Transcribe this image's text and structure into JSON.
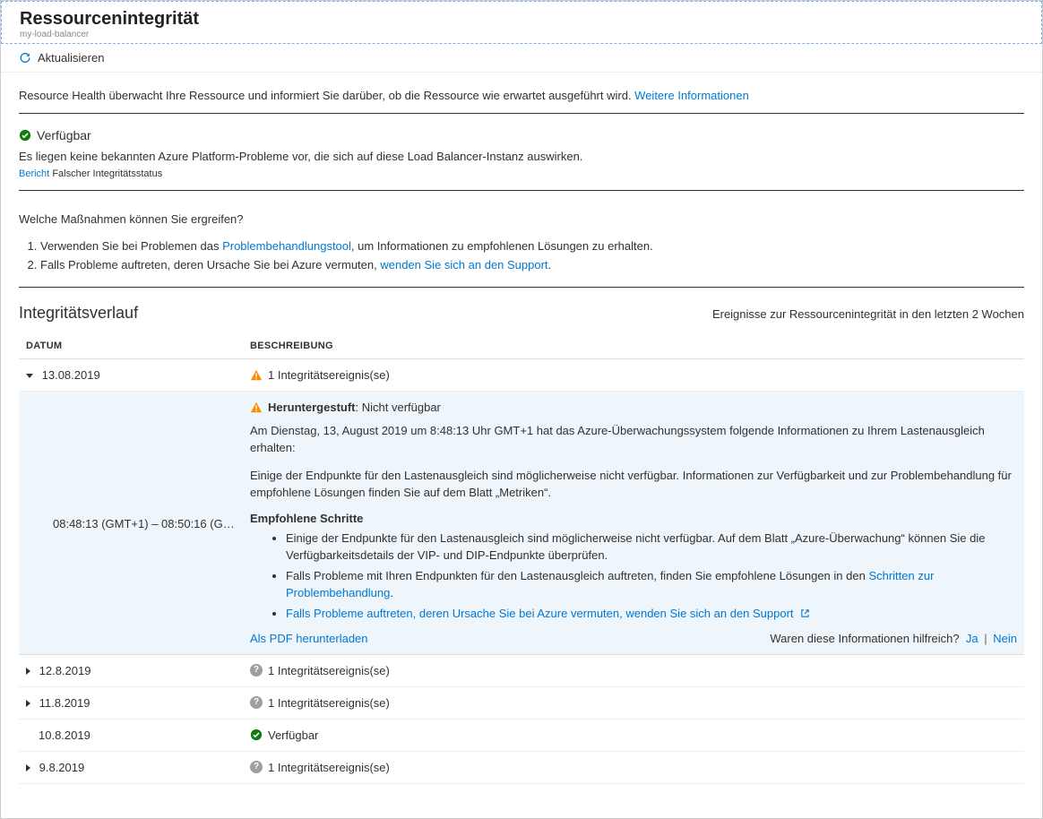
{
  "header": {
    "title": "Ressourcenintegrität",
    "subtitle": "my-load-balancer"
  },
  "toolbar": {
    "refresh_label": "Aktualisieren"
  },
  "intro": {
    "text": "Resource Health überwacht Ihre Ressource und informiert Sie darüber, ob die Ressource wie erwartet ausgeführt wird. ",
    "learn_more": "Weitere Informationen"
  },
  "status": {
    "label": "Verfügbar",
    "message": "Es liegen keine bekannten Azure Platform-Probleme vor, die sich auf diese Load Balancer-Instanz auswirken.",
    "report_link": "Bericht",
    "report_text": "Falscher Integritätsstatus"
  },
  "actions": {
    "question": "Welche Maßnahmen können Sie ergreifen?",
    "item1_a": "Verwenden Sie bei Problemen das ",
    "item1_link": "Problembehandlungstool",
    "item1_b": ", um Informationen zu empfohlenen Lösungen zu erhalten.",
    "item2_a": "Falls Probleme auftreten, deren Ursache Sie bei Azure vermuten, ",
    "item2_link": "wenden Sie sich an den Support",
    "item2_b": "."
  },
  "history": {
    "title": "Integritätsverlauf",
    "subtitle": "Ereignisse zur Ressourcenintegrität in den letzten 2 Wochen",
    "col_date": "Datum",
    "col_desc": "Beschreibung",
    "rows": [
      {
        "date": "13.08.2019",
        "desc": "1 Integritätsereignis(se)",
        "icon": "warn",
        "expanded": true
      },
      {
        "date": "12.8.2019",
        "desc": "1 Integritätsereignis(se)",
        "icon": "unknown"
      },
      {
        "date": "11.8.2019",
        "desc": "1 Integritätsereignis(se)",
        "icon": "unknown"
      },
      {
        "date": "10.8.2019",
        "desc": "Verfügbar",
        "icon": "ok",
        "no_caret": true
      },
      {
        "date": "9.8.2019",
        "desc": "1 Integritätsereignis(se)",
        "icon": "unknown"
      }
    ],
    "expanded": {
      "time_range": "08:48:13 (GMT+1) – 08:50:16 (GMT...",
      "status_label": "Heruntergestuft",
      "status_suffix": ": Nicht verfügbar",
      "p1": "Am Dienstag, 13, August 2019 um 8:48:13 Uhr GMT+1 hat das Azure-Überwachungssystem folgende Informationen zu Ihrem Lastenausgleich erhalten:",
      "p2": "Einige der Endpunkte für den Lastenausgleich sind möglicherweise nicht verfügbar. Informationen zur Verfügbarkeit und zur Problembehandlung für empfohlene Lösungen finden Sie auf dem Blatt „Metriken“.",
      "steps_heading": "Empfohlene Schritte",
      "step1": "Einige der Endpunkte für den Lastenausgleich sind möglicherweise nicht verfügbar. Auf dem Blatt „Azure-Überwachung“ können Sie die Verfügbarkeitsdetails der VIP- und DIP-Endpunkte überprüfen.",
      "step2_a": "Falls Probleme mit Ihren Endpunkten für den Lastenausgleich auftreten, finden Sie empfohlene Lösungen in den ",
      "step2_link": "Schritten zur Problembehandlung",
      "step2_b": ".",
      "step3_link": "Falls Probleme auftreten, deren Ursache Sie bei Azure vermuten, wenden Sie sich an den Support",
      "download_pdf": "Als PDF herunterladen",
      "helpful_q": "Waren diese Informationen hilfreich?",
      "yes": "Ja",
      "no": "Nein"
    }
  }
}
